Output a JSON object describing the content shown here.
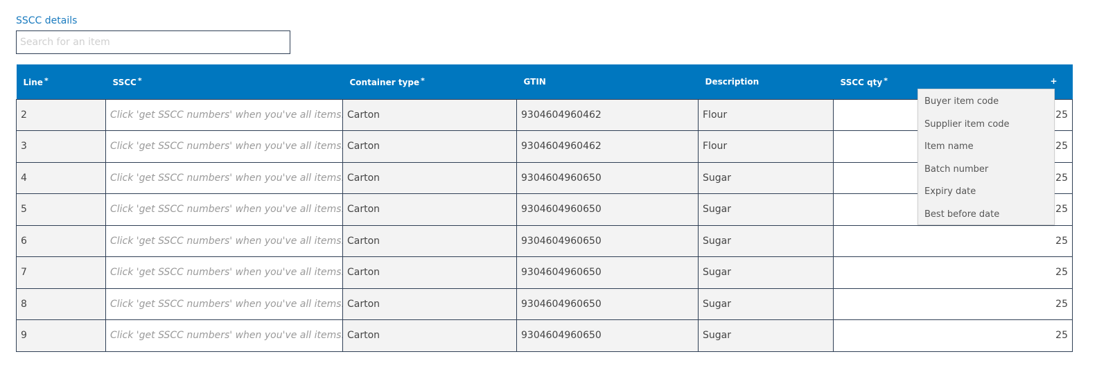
{
  "section": {
    "title": "SSCC details"
  },
  "search": {
    "placeholder": "Search for an item"
  },
  "table": {
    "columns": [
      {
        "label": "Line",
        "required": true
      },
      {
        "label": "SSCC",
        "required": true
      },
      {
        "label": "Container type",
        "required": true
      },
      {
        "label": "GTIN",
        "required": false
      },
      {
        "label": "Description",
        "required": false
      },
      {
        "label": "SSCC qty",
        "required": true
      }
    ],
    "required_mark": "*",
    "add_column_label": "+",
    "rows": [
      {
        "line": "2",
        "sscc": "Click 'get SSCC numbers' when you've all items.",
        "container": "Carton",
        "gtin": "9304604960462",
        "description": "Flour",
        "qty": "25"
      },
      {
        "line": "3",
        "sscc": "Click 'get SSCC numbers' when you've all items.",
        "container": "Carton",
        "gtin": "9304604960462",
        "description": "Flour",
        "qty": "25"
      },
      {
        "line": "4",
        "sscc": "Click 'get SSCC numbers' when you've all items.",
        "container": "Carton",
        "gtin": "9304604960650",
        "description": "Sugar",
        "qty": "25"
      },
      {
        "line": "5",
        "sscc": "Click 'get SSCC numbers' when you've all items.",
        "container": "Carton",
        "gtin": "9304604960650",
        "description": "Sugar",
        "qty": "25"
      },
      {
        "line": "6",
        "sscc": "Click 'get SSCC numbers' when you've all items.",
        "container": "Carton",
        "gtin": "9304604960650",
        "description": "Sugar",
        "qty": "25"
      },
      {
        "line": "7",
        "sscc": "Click 'get SSCC numbers' when you've all items.",
        "container": "Carton",
        "gtin": "9304604960650",
        "description": "Sugar",
        "qty": "25"
      },
      {
        "line": "8",
        "sscc": "Click 'get SSCC numbers' when you've all items.",
        "container": "Carton",
        "gtin": "9304604960650",
        "description": "Sugar",
        "qty": "25"
      },
      {
        "line": "9",
        "sscc": "Click 'get SSCC numbers' when you've all items.",
        "container": "Carton",
        "gtin": "9304604960650",
        "description": "Sugar",
        "qty": "25"
      }
    ]
  },
  "column_menu": {
    "items": [
      "Buyer item code",
      "Supplier item code",
      "Item name",
      "Batch number",
      "Expiry date",
      "Best before date"
    ]
  },
  "colors": {
    "header_bg": "#0077bf",
    "title": "#1a7bbf",
    "border": "#2f3f55",
    "readonly_cell": "#f3f3f3"
  }
}
